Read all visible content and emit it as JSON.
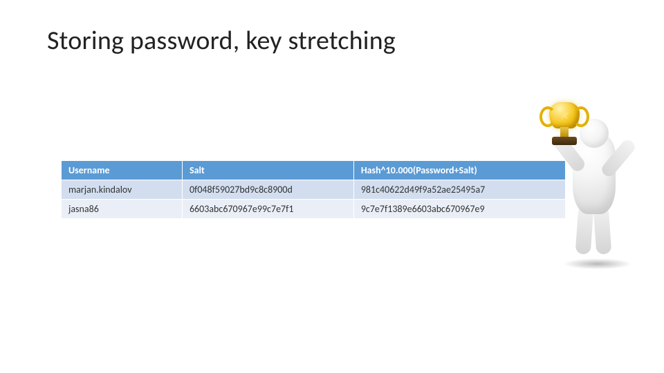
{
  "title": "Storing password, key stretching",
  "table": {
    "headers": [
      "Username",
      "Salt",
      "Hash^10.000(Password+Salt)"
    ],
    "rows": [
      {
        "username": "marjan.kindalov",
        "salt": "0f048f59027bd9c8c8900d",
        "hash": "981c40622d49f9a52ae25495a7"
      },
      {
        "username": "jasna86",
        "salt": "6603abc670967e99c7e7f1",
        "hash": "9c7e7f1389e6603abc670967e9"
      }
    ]
  },
  "decorative": {
    "icon": "trophy-figure"
  }
}
